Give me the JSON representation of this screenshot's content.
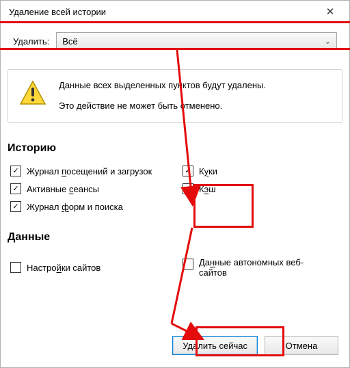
{
  "window": {
    "title": "Удаление всей истории",
    "close_glyph": "✕"
  },
  "delete_row": {
    "label": "Удалить:",
    "selected": "Всё"
  },
  "info": {
    "line1": "Данные всех выделенных пунктов будут удалены.",
    "line2": "Это действие не может быть отменено."
  },
  "sections": {
    "history": "Историю",
    "data": "Данные"
  },
  "history_checks": {
    "visits": {
      "label_pre": "Журнал ",
      "u": "п",
      "label_post": "осещений и загрузок",
      "checked": true
    },
    "sessions": {
      "label_pre": "Активные ",
      "u": "с",
      "label_post": "еансы",
      "checked": true
    },
    "forms": {
      "label_pre": "Журнал ",
      "u": "ф",
      "label_post": "орм и поиска",
      "checked": true
    },
    "cookies": {
      "label_pre": "К",
      "u": "у",
      "label_post": "ки",
      "checked": true
    },
    "cache": {
      "label_pre": "К",
      "u": "э",
      "label_post": "ш",
      "checked": true
    }
  },
  "data_checks": {
    "site_settings": {
      "label_pre": "Настро",
      "u": "й",
      "label_post": "ки сайтов",
      "checked": false
    },
    "offline": {
      "label_pre": "Да",
      "u": "н",
      "label_post": "ные автономных веб-сайтов",
      "checked": false
    }
  },
  "buttons": {
    "delete_now": "Удалить сейчас",
    "cancel": "Отмена"
  },
  "annotations": {
    "highlight_delete_row": true,
    "highlight_cookies_cache": true,
    "highlight_delete_button": true,
    "arrows": true
  }
}
